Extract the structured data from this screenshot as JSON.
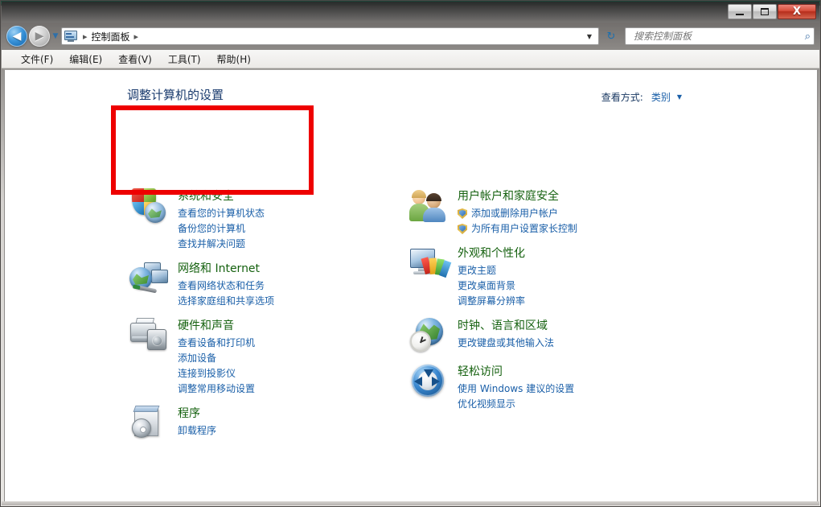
{
  "window": {
    "titlebar": {
      "minimize_label": "最小化",
      "maximize_label": "最大化",
      "close_label": "X"
    }
  },
  "toolbar": {
    "back_glyph": "◀",
    "forward_glyph": "▶",
    "recent_caret": "▼",
    "breadcrumb": {
      "icon": "control-panel-icon",
      "separator": "▸",
      "items": [
        "控制面板"
      ],
      "trailing_separator": "▸",
      "dropdown_caret": "▼"
    },
    "refresh_glyph": "↻",
    "search": {
      "placeholder": "搜索控制面板",
      "value": "",
      "icon_glyph": "⌕"
    }
  },
  "menubar": {
    "items": [
      {
        "label": "文件(F)"
      },
      {
        "label": "编辑(E)"
      },
      {
        "label": "查看(V)"
      },
      {
        "label": "工具(T)"
      },
      {
        "label": "帮助(H)"
      }
    ]
  },
  "page": {
    "heading": "调整计算机的设置",
    "view_by": {
      "label": "查看方式:",
      "value": "类别",
      "caret": "▼"
    }
  },
  "categories": {
    "left": [
      {
        "icon": "security-shield-icon",
        "title": "系统和安全",
        "links": [
          "查看您的计算机状态",
          "备份您的计算机",
          "查找并解决问题"
        ]
      },
      {
        "icon": "network-globe-icon",
        "title": "网络和 Internet",
        "links": [
          "查看网络状态和任务",
          "选择家庭组和共享选项"
        ]
      },
      {
        "icon": "printer-speaker-icon",
        "title": "硬件和声音",
        "links": [
          "查看设备和打印机",
          "添加设备",
          "连接到投影仪",
          "调整常用移动设置"
        ]
      },
      {
        "icon": "program-box-icon",
        "title": "程序",
        "links": [
          "卸载程序"
        ]
      }
    ],
    "right": [
      {
        "icon": "users-icon",
        "title": "用户帐户和家庭安全",
        "links": [
          "添加或删除用户帐户",
          "为所有用户设置家长控制"
        ],
        "shield_links": true
      },
      {
        "icon": "appearance-monitor-icon",
        "title": "外观和个性化",
        "links": [
          "更改主题",
          "更改桌面背景",
          "调整屏幕分辨率"
        ]
      },
      {
        "icon": "clock-globe-icon",
        "title": "时钟、语言和区域",
        "links": [
          "更改键盘或其他输入法"
        ]
      },
      {
        "icon": "ease-of-access-icon",
        "title": "轻松访问",
        "links": [
          "使用 Windows 建议的设置",
          "优化视频显示"
        ]
      }
    ]
  },
  "annotation": {
    "highlight_color": "#ee0000",
    "target": "系统和安全"
  }
}
